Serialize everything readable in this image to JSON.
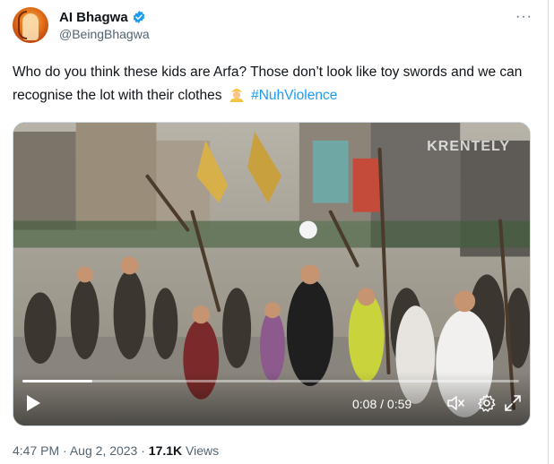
{
  "author": {
    "display_name": "AI Bhagwa",
    "handle": "@BeingBhagwa",
    "verified": true
  },
  "tweet": {
    "text_before": "Who do you think these kids are Arfa? Those don’t look like toy swords and we can recognise the lot with their clothes",
    "emoji": "person-wearing-turban-emoji",
    "hashtag": "#NuhViolence"
  },
  "media": {
    "watermark": "KRENTELY",
    "progress_fraction": 0.14,
    "time_display": "0:08 / 0:59",
    "icons": [
      "play-icon",
      "mute-icon",
      "settings-icon",
      "fullscreen-icon"
    ]
  },
  "footer": {
    "timestamp": "4:47 PM",
    "separator": "·",
    "date": "Aug 2, 2023",
    "views_count": "17.1K",
    "views_label": "Views"
  },
  "colors": {
    "accent": "#1d9bf0",
    "text": "#0f1419",
    "secondary": "#536471"
  }
}
